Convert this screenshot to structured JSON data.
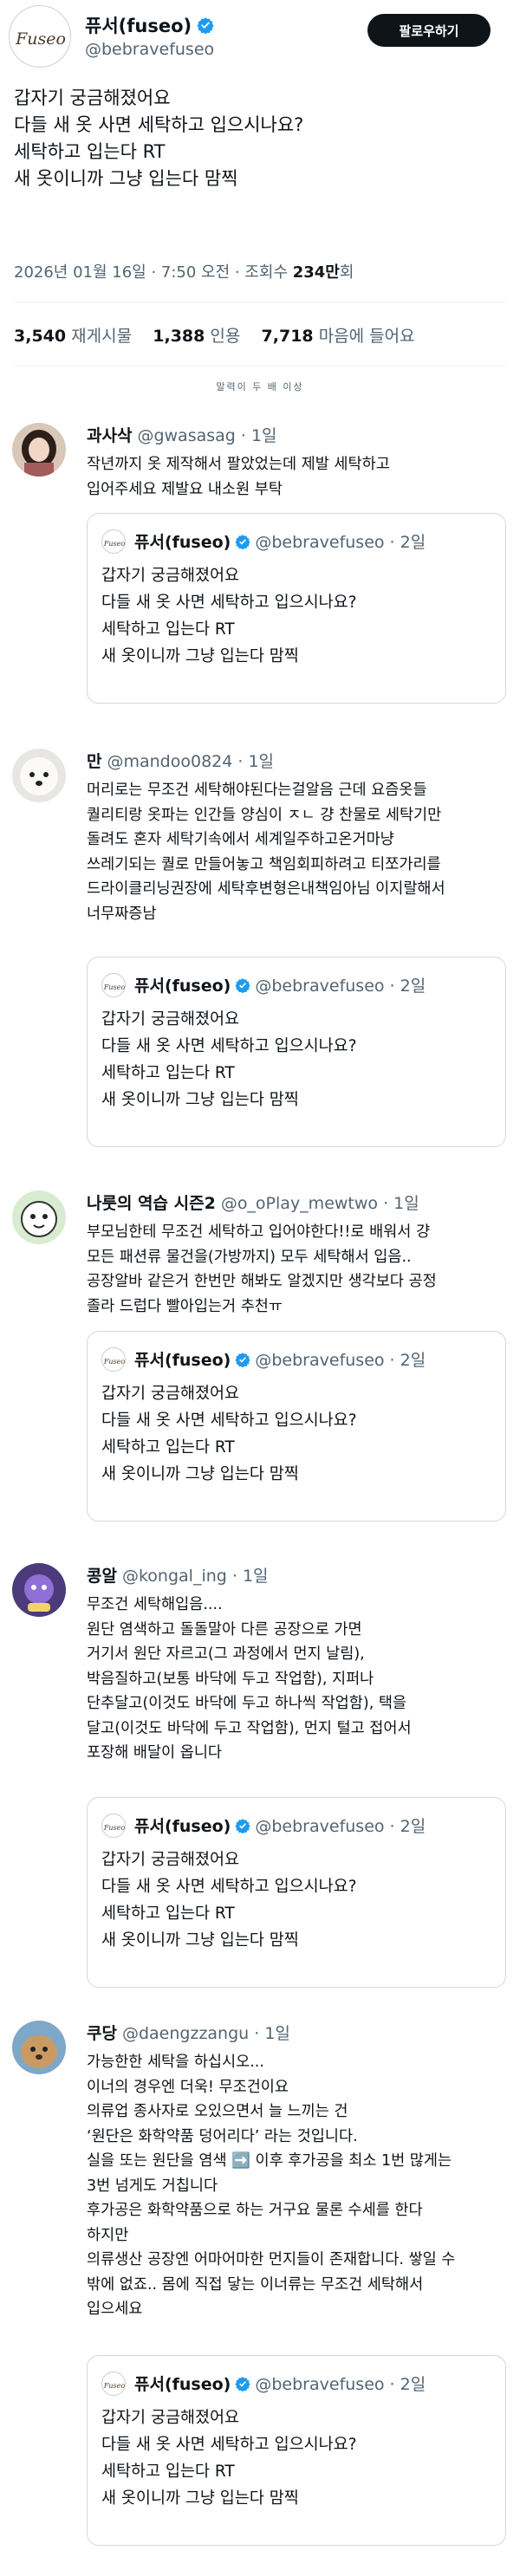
{
  "tweet": {
    "author_name": "퓨서(fuseo)",
    "author_handle": "@bebravefuseo",
    "avatar_logo_text": "Fuseo",
    "follow_label": "팔로우하기",
    "lines": [
      "갑자기 궁금해졌어요",
      "다들 새 옷 사면 세탁하고 입으시나요?",
      "",
      "세탁하고 입는다 RT",
      "새 옷이니까 그냥 입는다 맘찍"
    ],
    "meta_prefix": "2026년 01월 16일 · 7:50 오전 · 조회수 ",
    "views": "234만",
    "views_suffix": "회",
    "stats": [
      {
        "count": "3,540",
        "label": "재게시물"
      },
      {
        "count": "1,388",
        "label": "인용"
      },
      {
        "count": "7,718",
        "label": "마음에 들어요"
      }
    ],
    "sort_label": "말력이 두 배 이상"
  },
  "quote": {
    "author_name": "퓨서(fuseo)",
    "handle_time": "@bebravefuseo · 2일",
    "lines": [
      "갑자기 궁금해졌어요",
      "다들 새 옷 사면 세탁하고 입으시나요?",
      "",
      "세탁하고 입는다 RT",
      "새 옷이니까 그냥 입는다 맘찍"
    ]
  },
  "replies": [
    {
      "name": "과사삭",
      "handle_time": "@gwasasag · 1일",
      "avatar": "woman-avatar",
      "lines": [
        "작년까지 옷 제작해서 팔았었는데 제발 세탁하고",
        "입어주세요 제발요 내소원 부탁"
      ]
    },
    {
      "name": "만",
      "handle_time": "@mandoo0824 · 1일",
      "avatar": "dog-avatar",
      "lines": [
        "머리로는 무조건 세탁해야된다는걸알음 근데 요즘옷들",
        "퀄리티랑 옷파는 인간들 양심이 ㅈㄴ 걍 찬물로 세탁기만",
        "돌려도 혼자 세탁기속에서 세계일주하고온거마냥",
        "쓰레기되는 퀄로 만들어놓고 책임회피하려고 티쪼가리를",
        "드라이클리닝권장에 세탁후변형은내책임아님 이지랄해서",
        "너무짜증남"
      ]
    },
    {
      "name": "나룻의 역습 시즌2",
      "handle_time": "@o_oPlay_mewtwo · 1일",
      "avatar": "character-avatar",
      "lines": [
        "부모님한테 무조건 세탁하고 입어야한다!!로 배워서 걍",
        "모든 패션류 물건을(가방까지) 모두 세탁해서 입음..",
        "공장알바 같은거 한번만 해봐도 알겠지만 생각보다 공정",
        "졸라 드럽다 빨아입는거 추천ㅠ"
      ]
    },
    {
      "name": "콩알",
      "handle_time": "@kongal_ing · 1일",
      "avatar": "purple-avatar",
      "lines": [
        "무조건 세탁해입음....",
        "원단 염색하고 돌돌말아 다른 공장으로 가면",
        "거기서 원단 자르고(그 과정에서 먼지 날림),",
        "박음질하고(보통 바닥에 두고 작업함), 지퍼나",
        "단추달고(이것도 바닥에 두고 하나씩 작업함), 택을",
        "달고(이것도 바닥에 두고 작업함), 먼지 털고 접어서",
        "포장해 배달이 옵니다"
      ]
    },
    {
      "name": "쿠당",
      "handle_time": "@daengzzangu · 1일",
      "avatar": "puppy-avatar",
      "lines": [
        "가능한한 세탁을 하십시오...",
        "이너의 경우엔 더욱! 무조건이요",
        "의류업 종사자로 오있으면서 늘 느끼는 건",
        "‘원단은 화학약품 덩어리다’ 라는 것입니다.",
        "실을 또는 원단을 염색 ➡️ 이후 후가공을 최소 1번 많게는",
        "3번 넘게도 거칩니다",
        "후가공은 화학약품으로 하는 거구요 물론 수세를 한다",
        "하지만",
        "의류생산 공장엔 어마어마한 먼지들이 존재합니다. 쌓일 수",
        "밖에 없죠.. 몸에 직접 닿는 이너류는 무조건 세탁해서",
        "입으세요"
      ]
    }
  ]
}
